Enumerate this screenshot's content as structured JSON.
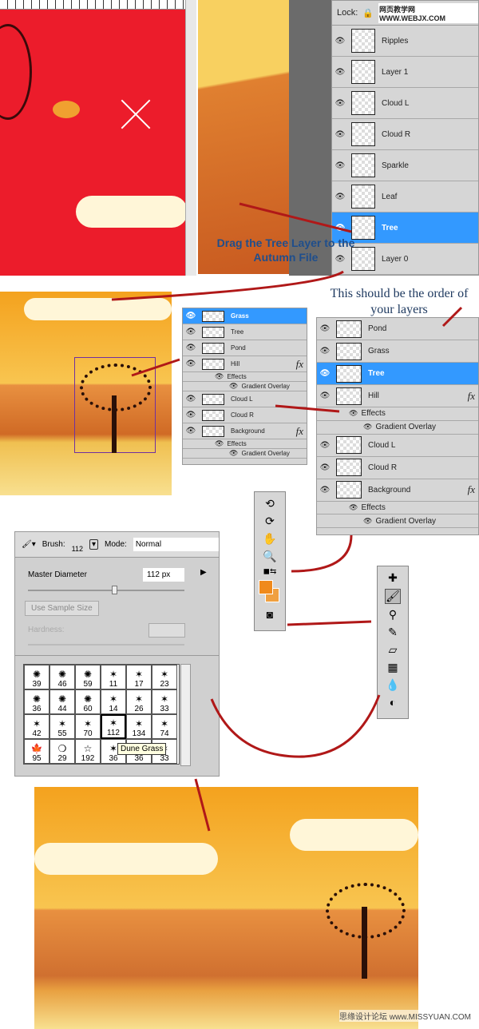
{
  "top_layers": {
    "lock_label": "Lock:",
    "watermark": "网页教学网 WWW.WEBJX.COM",
    "layers": [
      {
        "name": "Ripples"
      },
      {
        "name": "Layer 1"
      },
      {
        "name": "Cloud L"
      },
      {
        "name": "Cloud R"
      },
      {
        "name": "Sparkle"
      },
      {
        "name": "Leaf"
      },
      {
        "name": "Tree",
        "selected": true
      },
      {
        "name": "Layer 0"
      }
    ]
  },
  "caption1": "Drag the Tree Layer to the Autumn File",
  "caption2": "This should be the order of your layers",
  "small_layers": [
    {
      "name": "Grass",
      "selected": true
    },
    {
      "name": "Tree"
    },
    {
      "name": "Pond"
    },
    {
      "name": "Hill",
      "fx": "fx"
    },
    {
      "name": "Effects",
      "level": 1
    },
    {
      "name": "Gradient Overlay",
      "level": 2
    },
    {
      "name": "Cloud L"
    },
    {
      "name": "Cloud R"
    },
    {
      "name": "Background",
      "fx": "fx"
    },
    {
      "name": "Effects",
      "level": 1
    },
    {
      "name": "Gradient Overlay",
      "level": 2
    }
  ],
  "big_layers": [
    {
      "name": "Pond"
    },
    {
      "name": "Grass"
    },
    {
      "name": "Tree",
      "selected": true
    },
    {
      "name": "Hill",
      "fx": "fx"
    },
    {
      "name": "Effects",
      "level": 1
    },
    {
      "name": "Gradient Overlay",
      "level": 2
    },
    {
      "name": "Cloud L"
    },
    {
      "name": "Cloud R"
    },
    {
      "name": "Background",
      "fx": "fx"
    },
    {
      "name": "Effects",
      "level": 1
    },
    {
      "name": "Gradient Overlay",
      "level": 2
    }
  ],
  "brush": {
    "brush_label": "Brush:",
    "brush_size": "112",
    "mode_label": "Mode:",
    "mode_value": "Normal",
    "master_diameter_label": "Master Diameter",
    "diameter_value": "112 px",
    "use_sample_size": "Use Sample Size",
    "hardness_label": "Hardness:",
    "slider_fraction": 0.55,
    "tooltip": "Dune Grass",
    "presets": [
      "39",
      "46",
      "59",
      "11",
      "17",
      "23",
      "36",
      "44",
      "60",
      "14",
      "26",
      "33",
      "42",
      "55",
      "70",
      "112",
      "134",
      "74",
      "95",
      "29",
      "192",
      "36",
      "36",
      "33"
    ],
    "selected_preset": "112"
  },
  "colors": {
    "foreground": "#f08a1c",
    "background": "#f0a040",
    "arrow": "#b01818",
    "selected": "#3399ff"
  },
  "footer_watermark": "思缘设计论坛 www.MISSYUAN.COM"
}
